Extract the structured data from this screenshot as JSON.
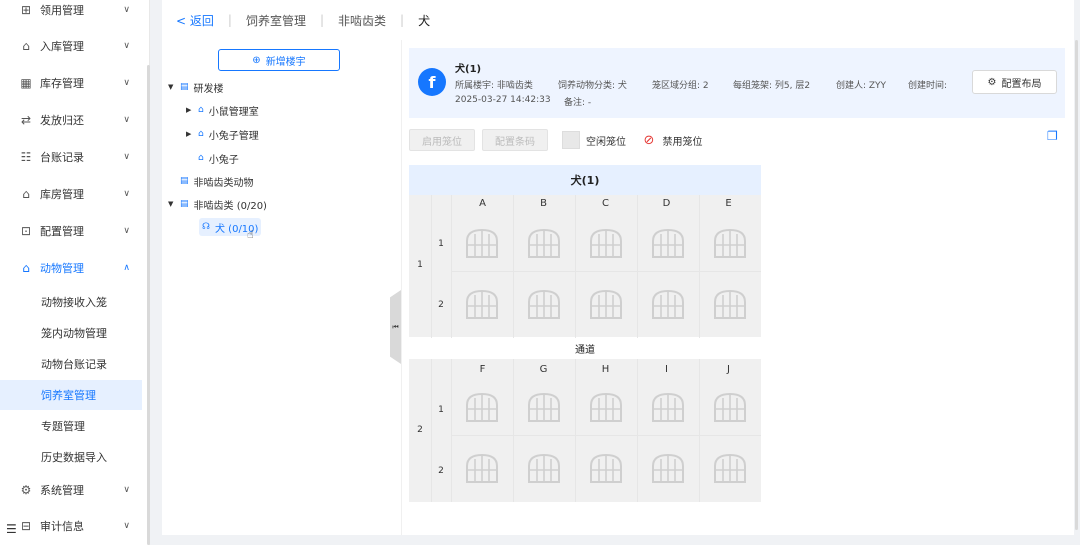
{
  "sidebar": {
    "menus": [
      {
        "icon": "receive-icon",
        "label": "领用管理"
      },
      {
        "icon": "warehouse-in-icon",
        "label": "入库管理"
      },
      {
        "icon": "inventory-icon",
        "label": "库存管理"
      },
      {
        "icon": "dispatch-icon",
        "label": "发放归还"
      },
      {
        "icon": "ledger-icon",
        "label": "台账记录"
      },
      {
        "icon": "storeroom-icon",
        "label": "库房管理"
      },
      {
        "icon": "config-icon",
        "label": "配置管理"
      },
      {
        "icon": "animal-icon",
        "label": "动物管理"
      },
      {
        "icon": "system-icon",
        "label": "系统管理"
      },
      {
        "icon": "audit-icon",
        "label": "审计信息"
      }
    ],
    "submenu": [
      "动物接收入笼",
      "笼内动物管理",
      "动物台账记录",
      "饲养室管理",
      "专题管理",
      "历史数据导入"
    ]
  },
  "topbar": {
    "back": "返回",
    "crumbs": [
      "饲养室管理",
      "非啮齿类",
      "犬"
    ]
  },
  "tree": {
    "new_button": "新增楼宇",
    "nodes": [
      "研发楼",
      "小鼠管理室",
      "小兔子管理",
      "小兔子",
      "非啮齿类动物",
      "非啮齿类 (0/20)",
      "犬 (0/10)"
    ]
  },
  "info": {
    "title": "犬(1)",
    "building": "所属楼宇: 非啮齿类",
    "category": "饲养动物分类: 犬",
    "zones": "笼区域分组: 2",
    "per_group": "每组笼架: 列5, 层2",
    "creator": "创建人: ZYY",
    "created_time": "创建时间:",
    "date": "2025-03-27 14:42:33",
    "remark": "备注: -",
    "config_layout": "配置布局"
  },
  "actions": {
    "enable_cage": "启用笼位",
    "config_barcode": "配置条码",
    "empty_cage": "空闲笼位",
    "disable_cage": "禁用笼位"
  },
  "grid": {
    "title": "犬(1)",
    "aisle": "通道",
    "block1": {
      "label": "1",
      "rows": [
        "1",
        "2"
      ],
      "cols": [
        "A",
        "B",
        "C",
        "D",
        "E"
      ]
    },
    "block2": {
      "label": "2",
      "rows": [
        "1",
        "2"
      ],
      "cols": [
        "F",
        "G",
        "H",
        "I",
        "J"
      ]
    }
  }
}
